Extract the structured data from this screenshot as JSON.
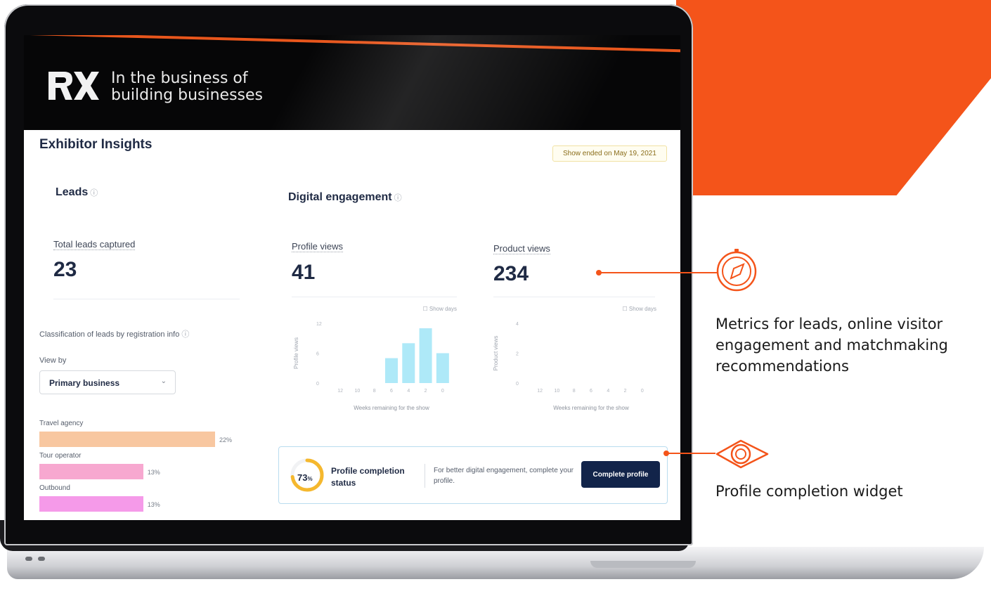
{
  "brand": {
    "logo_text": "RX",
    "tagline_line1": "In the business of",
    "tagline_line2": "building businesses",
    "accent": "#f4541a"
  },
  "app": {
    "title": "Exhibitor Insights",
    "show_status": "Show ended on May 19, 2021",
    "info_icon": "ⓘ"
  },
  "leads": {
    "heading": "Leads",
    "total_label": "Total leads captured",
    "total_value": "23",
    "classification_label": "Classification of leads by registration info",
    "view_by_label": "View by",
    "view_by_value": "Primary business",
    "items": [
      {
        "label": "Travel agency",
        "percent": "22%",
        "value": 22,
        "color": "#f8c7a0"
      },
      {
        "label": "Tour operator",
        "percent": "13%",
        "value": 13,
        "color": "#f7a8d0"
      },
      {
        "label": "Outbound",
        "percent": "13%",
        "value": 13,
        "color": "#f59ae9"
      }
    ]
  },
  "digital": {
    "heading": "Digital engagement",
    "profile_views_label": "Profile views",
    "profile_views_value": "41",
    "product_views_label": "Product views",
    "product_views_value": "234"
  },
  "chart_data": [
    {
      "type": "bar",
      "ylabel": "Profile views",
      "xlabel": "Weeks remaining for the show",
      "toggle": "Show days",
      "categories": [
        "12",
        "10",
        "8",
        "6",
        "4",
        "2",
        "0"
      ],
      "values": [
        0,
        0,
        0,
        5,
        8,
        11,
        6
      ],
      "yticks": [
        "0",
        "6",
        "12"
      ],
      "ylim": [
        0,
        12
      ],
      "color": "#aee9f8"
    },
    {
      "type": "bar",
      "ylabel": "Product views",
      "xlabel": "Weeks remaining for the show",
      "toggle": "Show days",
      "categories": [
        "12",
        "10",
        "8",
        "6",
        "4",
        "2",
        "0"
      ],
      "values": [
        0,
        0,
        0,
        0,
        0,
        0,
        0
      ],
      "yticks": [
        "0",
        "2",
        "4"
      ],
      "ylim": [
        0,
        4
      ],
      "color": "#aee9f8"
    }
  ],
  "profile_widget": {
    "percent_value": 73,
    "percent_text": "73",
    "percent_unit": "%",
    "title": "Profile completion status",
    "text": "For better digital engagement, complete your profile.",
    "button": "Complete profile"
  },
  "callouts": {
    "metrics": "Metrics for leads, online visitor engagement and matchmaking recommendations",
    "metrics_icon": "compass-icon",
    "widget": "Profile completion widget",
    "widget_icon": "eye-icon"
  }
}
